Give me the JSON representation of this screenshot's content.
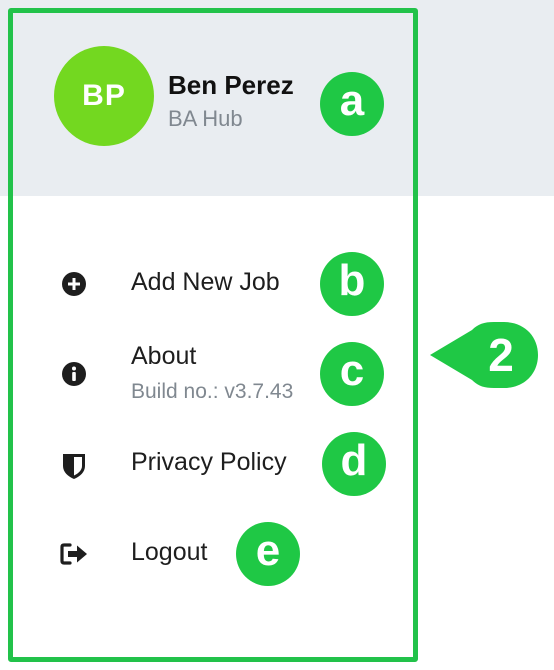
{
  "profile": {
    "initials": "BP",
    "name": "Ben Perez",
    "organization": "BA Hub",
    "avatar_color": "#73d820"
  },
  "menu": {
    "items": [
      {
        "label": "Add New Job",
        "icon": "plus-circle-icon"
      },
      {
        "label": "About",
        "sublabel": "Build no.: v3.7.43",
        "icon": "info-circle-icon"
      },
      {
        "label": "Privacy Policy",
        "icon": "shield-icon"
      },
      {
        "label": "Logout",
        "icon": "logout-icon"
      }
    ]
  },
  "annotations": {
    "callouts": [
      "a",
      "b",
      "c",
      "d",
      "e"
    ],
    "section_marker": "2",
    "highlight_color": "#22c24a"
  }
}
